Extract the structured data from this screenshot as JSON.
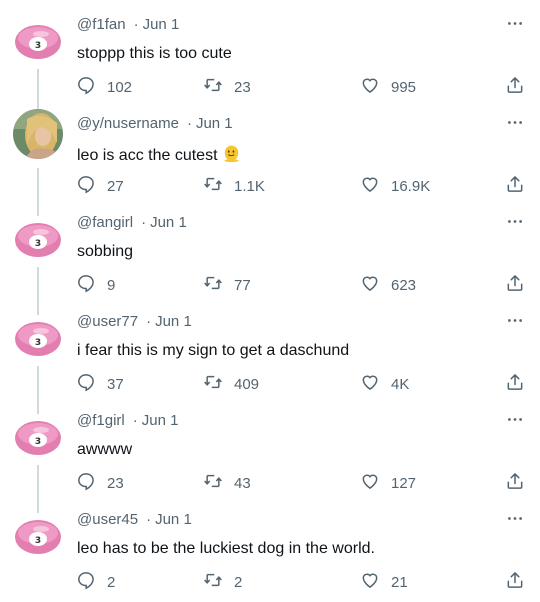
{
  "replies": [
    {
      "handle": "@f1fan",
      "date": "Jun 1",
      "text": "stoppp this is too cute",
      "replies": "102",
      "retweets": "23",
      "likes": "995",
      "avatar": "billiard-ball-3",
      "emoji": ""
    },
    {
      "handle": "@y/nusername",
      "date": "Jun 1",
      "text": "leo is acc the cutest",
      "replies": "27",
      "retweets": "1.1K",
      "likes": "16.9K",
      "avatar": "photo-blonde-person",
      "emoji": "🫠"
    },
    {
      "handle": "@fangirl",
      "date": "Jun 1",
      "text": "sobbing",
      "replies": "9",
      "retweets": "77",
      "likes": "623",
      "avatar": "billiard-ball-3",
      "emoji": ""
    },
    {
      "handle": "@user77",
      "date": "Jun 1",
      "text": "i fear this is my sign to get a daschund",
      "replies": "37",
      "retweets": "409",
      "likes": "4K",
      "avatar": "billiard-ball-3",
      "emoji": ""
    },
    {
      "handle": "@f1girl",
      "date": "Jun 1",
      "text": "awwww",
      "replies": "23",
      "retweets": "43",
      "likes": "127",
      "avatar": "billiard-ball-3",
      "emoji": ""
    },
    {
      "handle": "@user45",
      "date": "Jun 1",
      "text": "leo has to be the luckiest dog in the world.",
      "replies": "2",
      "retweets": "2",
      "likes": "21",
      "avatar": "billiard-ball-3",
      "emoji": ""
    }
  ],
  "colors": {
    "text_primary": "#0f1419",
    "text_secondary": "#536471",
    "connector": "#cfd9de",
    "ball_pink": "#e27fb0"
  },
  "icons": {
    "reply": "reply-bubble-icon",
    "retweet": "retweet-icon",
    "like": "heart-icon",
    "share": "share-icon",
    "more": "more-dots-icon"
  }
}
